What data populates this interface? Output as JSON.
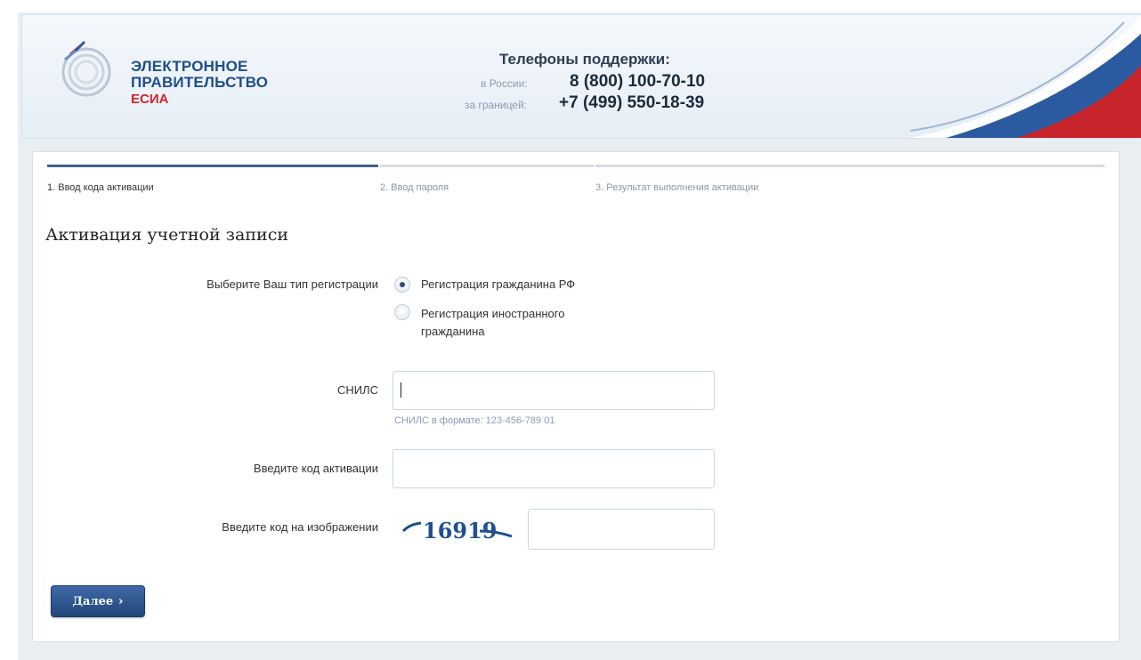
{
  "header": {
    "logo": {
      "line1": "ЭЛЕКТРОННОЕ",
      "line2": "ПРАВИТЕЛЬСТВО",
      "line3": "ЕСИА"
    },
    "support": {
      "title": "Телефоны поддержки:",
      "russia_label": "в России:",
      "russia_phone": "8 (800) 100-70-10",
      "abroad_label": "за границей:",
      "abroad_phone": "+7 (499) 550-18-39"
    }
  },
  "steps": [
    {
      "label": "1. Ввод кода активации",
      "active": true
    },
    {
      "label": "2. Ввод пароля",
      "active": false
    },
    {
      "label": "3. Результат выполнения активации",
      "active": false
    }
  ],
  "page_title": "Активация учетной записи",
  "form": {
    "registration_type_label": "Выберите Ваш тип регистрации",
    "options": [
      {
        "label": "Регистрация гражданина РФ",
        "checked": true
      },
      {
        "label": "Регистрация иностранного гражданина",
        "checked": false
      }
    ],
    "snils_label": "СНИЛС",
    "snils_value": "",
    "snils_hint": "СНИЛС в формате: 123-456-789 01",
    "activation_code_label": "Введите код активации",
    "activation_code_value": "",
    "captcha_label": "Введите код на изображении",
    "captcha_text": "16919",
    "captcha_value": ""
  },
  "next_button": "Далее",
  "colors": {
    "brand_blue": "#1e4e8c",
    "brand_red": "#d0252b",
    "button_blue": "#2b5390",
    "active_step": "#3f618d"
  }
}
